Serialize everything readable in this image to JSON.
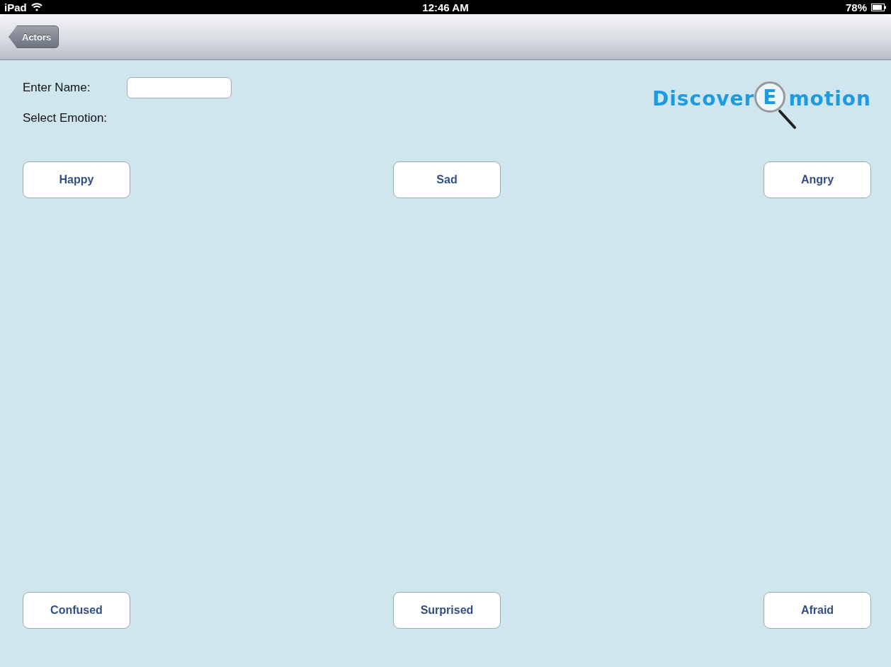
{
  "status_bar": {
    "device": "iPad",
    "time": "12:46 AM",
    "battery": "78%"
  },
  "nav_bar": {
    "back_button": "Actors"
  },
  "form": {
    "name_label": "Enter Name:",
    "emotion_label": "Select Emotion:"
  },
  "logo": {
    "before": "Discover",
    "letter": "E",
    "after": "motion"
  },
  "emotion_buttons_top": [
    "Happy",
    "Sad",
    "Angry"
  ],
  "emotion_buttons_bottom": [
    "Confused",
    "Surprised",
    "Afraid"
  ]
}
